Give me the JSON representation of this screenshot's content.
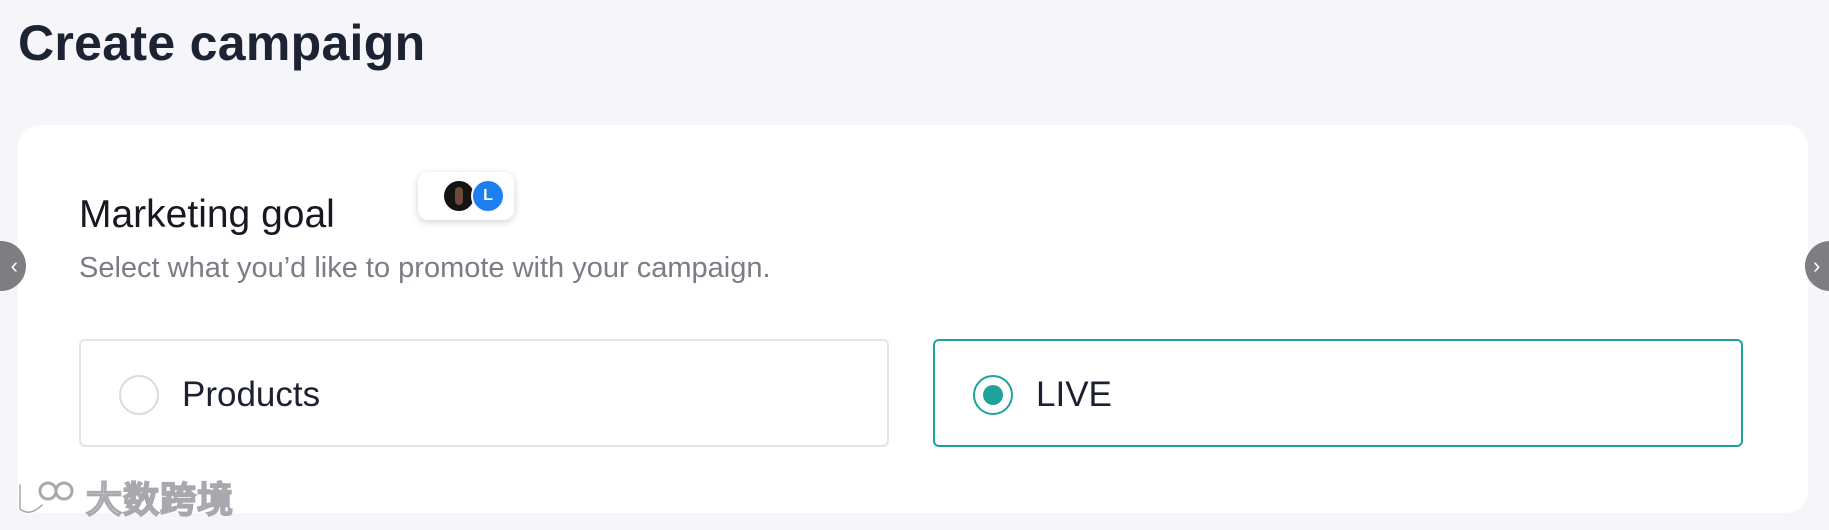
{
  "header": {
    "title": "Create campaign"
  },
  "marketing_goal": {
    "title": "Marketing goal",
    "subtitle": "Select what you’d like to promote with your campaign.",
    "collaborator_avatar_initial": "L",
    "options": [
      {
        "label": "Products",
        "selected": false
      },
      {
        "label": "LIVE",
        "selected": true
      }
    ]
  },
  "navigation": {
    "prev_icon": "chevron-left-icon",
    "next_icon": "chevron-right-icon",
    "prev_glyph": "‹",
    "next_glyph": "›"
  },
  "watermark": {
    "text": "大数跨境"
  },
  "colors": {
    "accent": "#1ea39a",
    "background": "#f5f5fa",
    "card": "#ffffff",
    "avatar_blue": "#1e7ff0"
  }
}
